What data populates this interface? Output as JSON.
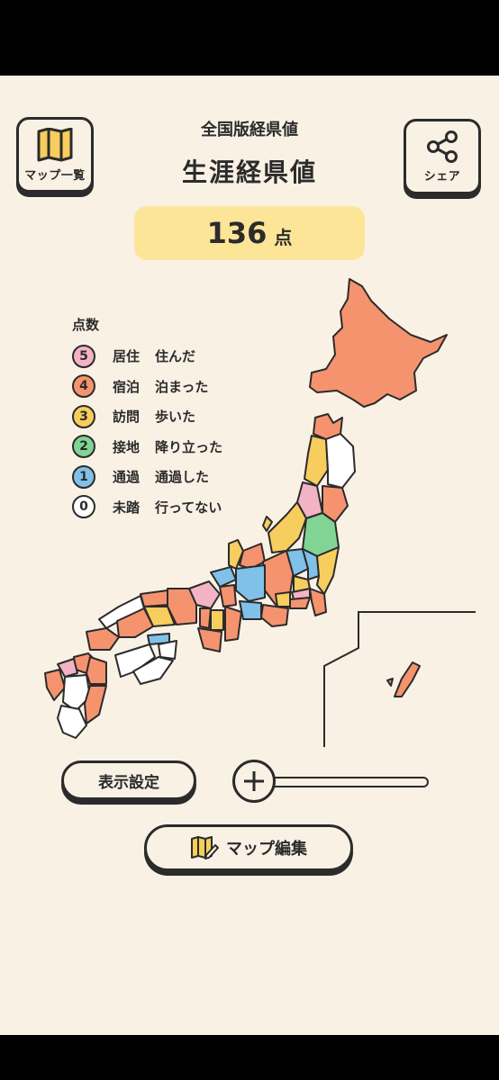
{
  "header": {
    "map_list_label": "マップ一覧",
    "subtitle": "全国版経県値",
    "title": "生涯経県値",
    "share_label": "シェア"
  },
  "score": {
    "value": "136",
    "unit": "点"
  },
  "legend": {
    "heading": "点数",
    "items": [
      {
        "num": "5",
        "level": "居住",
        "desc": "住んだ",
        "color": "#f2b3c5"
      },
      {
        "num": "4",
        "level": "宿泊",
        "desc": "泊まった",
        "color": "#f6936f"
      },
      {
        "num": "3",
        "level": "訪問",
        "desc": "歩いた",
        "color": "#f7cd5d"
      },
      {
        "num": "2",
        "level": "接地",
        "desc": "降り立った",
        "color": "#82d494"
      },
      {
        "num": "1",
        "level": "通過",
        "desc": "通過した",
        "color": "#7fc1e8"
      },
      {
        "num": "0",
        "level": "未踏",
        "desc": "行ってない",
        "color": "#ffffff"
      }
    ]
  },
  "colors": {
    "background": "#faf1e5",
    "ink": "#2b2b2b",
    "score_box": "#fde597"
  },
  "controls": {
    "display_settings_label": "表示設定",
    "map_edit_label": "マップ編集"
  }
}
